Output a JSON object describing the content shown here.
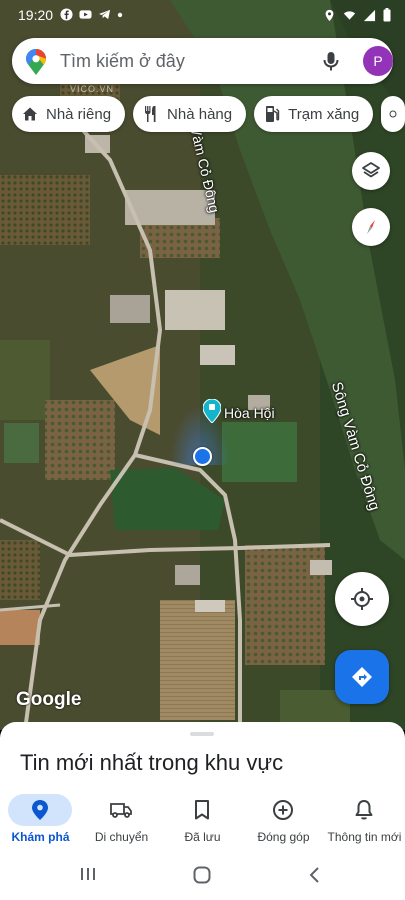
{
  "status_bar": {
    "time": "19:20",
    "left_icons": [
      "facebook-icon",
      "youtube-icon",
      "telegram-icon",
      "dot-icon"
    ],
    "right_icons": [
      "location-icon",
      "wifi-icon",
      "signal-icon",
      "battery-icon"
    ]
  },
  "search": {
    "placeholder": "Tìm kiếm ở đây",
    "avatar_letter": "P",
    "avatar_color": "#9334b8"
  },
  "chips": [
    {
      "label": "Nhà riêng",
      "icon": "home-icon"
    },
    {
      "label": "Nhà hàng",
      "icon": "restaurant-icon"
    },
    {
      "label": "Trạm xăng",
      "icon": "gas-station-icon"
    }
  ],
  "map": {
    "river_label_1": "Vàm Cỏ Đông",
    "river_label_2": "Sông Vàm Cỏ Đông",
    "place_label": "Hòa Hội",
    "watermark": "VICO.VN",
    "attribution": "Google"
  },
  "sheet": {
    "title": "Tin mới nhất trong khu vực"
  },
  "nav": {
    "items": [
      {
        "label": "Khám phá",
        "icon": "explore-pin-icon",
        "active": true
      },
      {
        "label": "Di chuyển",
        "icon": "car-icon",
        "active": false
      },
      {
        "label": "Đã lưu",
        "icon": "bookmark-icon",
        "active": false
      },
      {
        "label": "Đóng góp",
        "icon": "add-circle-icon",
        "active": false
      },
      {
        "label": "Thông tin mới",
        "icon": "bell-icon",
        "active": false
      }
    ]
  },
  "colors": {
    "accent": "#1a73e8",
    "active_pill": "#d2e3fc",
    "river": "#3e5a33"
  }
}
